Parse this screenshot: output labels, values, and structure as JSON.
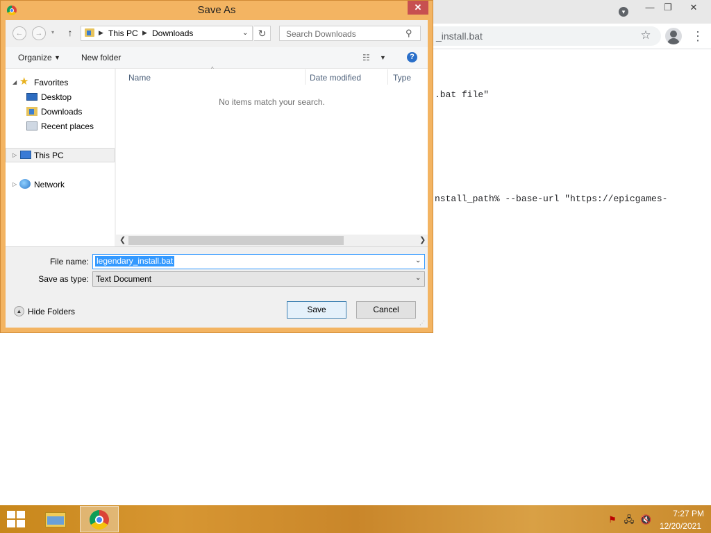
{
  "browser": {
    "url_fragment": "_install.bat",
    "code_lines": [
      ".bat file\"",
      "nstall_path% --base-url \"https://epicgames-"
    ]
  },
  "dialog": {
    "title": "Save As",
    "close_glyph": "✕",
    "address": {
      "crumbs": [
        "This PC",
        "Downloads"
      ]
    },
    "search_placeholder": "Search Downloads",
    "command_bar": {
      "organize": "Organize",
      "new_folder": "New folder"
    },
    "nav_pane": {
      "favorites": "Favorites",
      "desktop": "Desktop",
      "downloads": "Downloads",
      "recent_places": "Recent places",
      "this_pc": "This PC",
      "network": "Network"
    },
    "columns": [
      "Name",
      "Date modified",
      "Type"
    ],
    "empty_message": "No items match your search.",
    "file_name_label": "File name:",
    "file_name_value": "legendary_install.bat",
    "save_as_type_label": "Save as type:",
    "save_as_type_value": "Text Document",
    "hide_folders": "Hide Folders",
    "save_button": "Save",
    "cancel_button": "Cancel"
  },
  "taskbar": {
    "time": "7:27 PM",
    "date": "12/20/2021"
  },
  "colors": {
    "dialog_frame": "#f3b462",
    "taskbar": "#d1922e",
    "selection": "#3399ff"
  }
}
